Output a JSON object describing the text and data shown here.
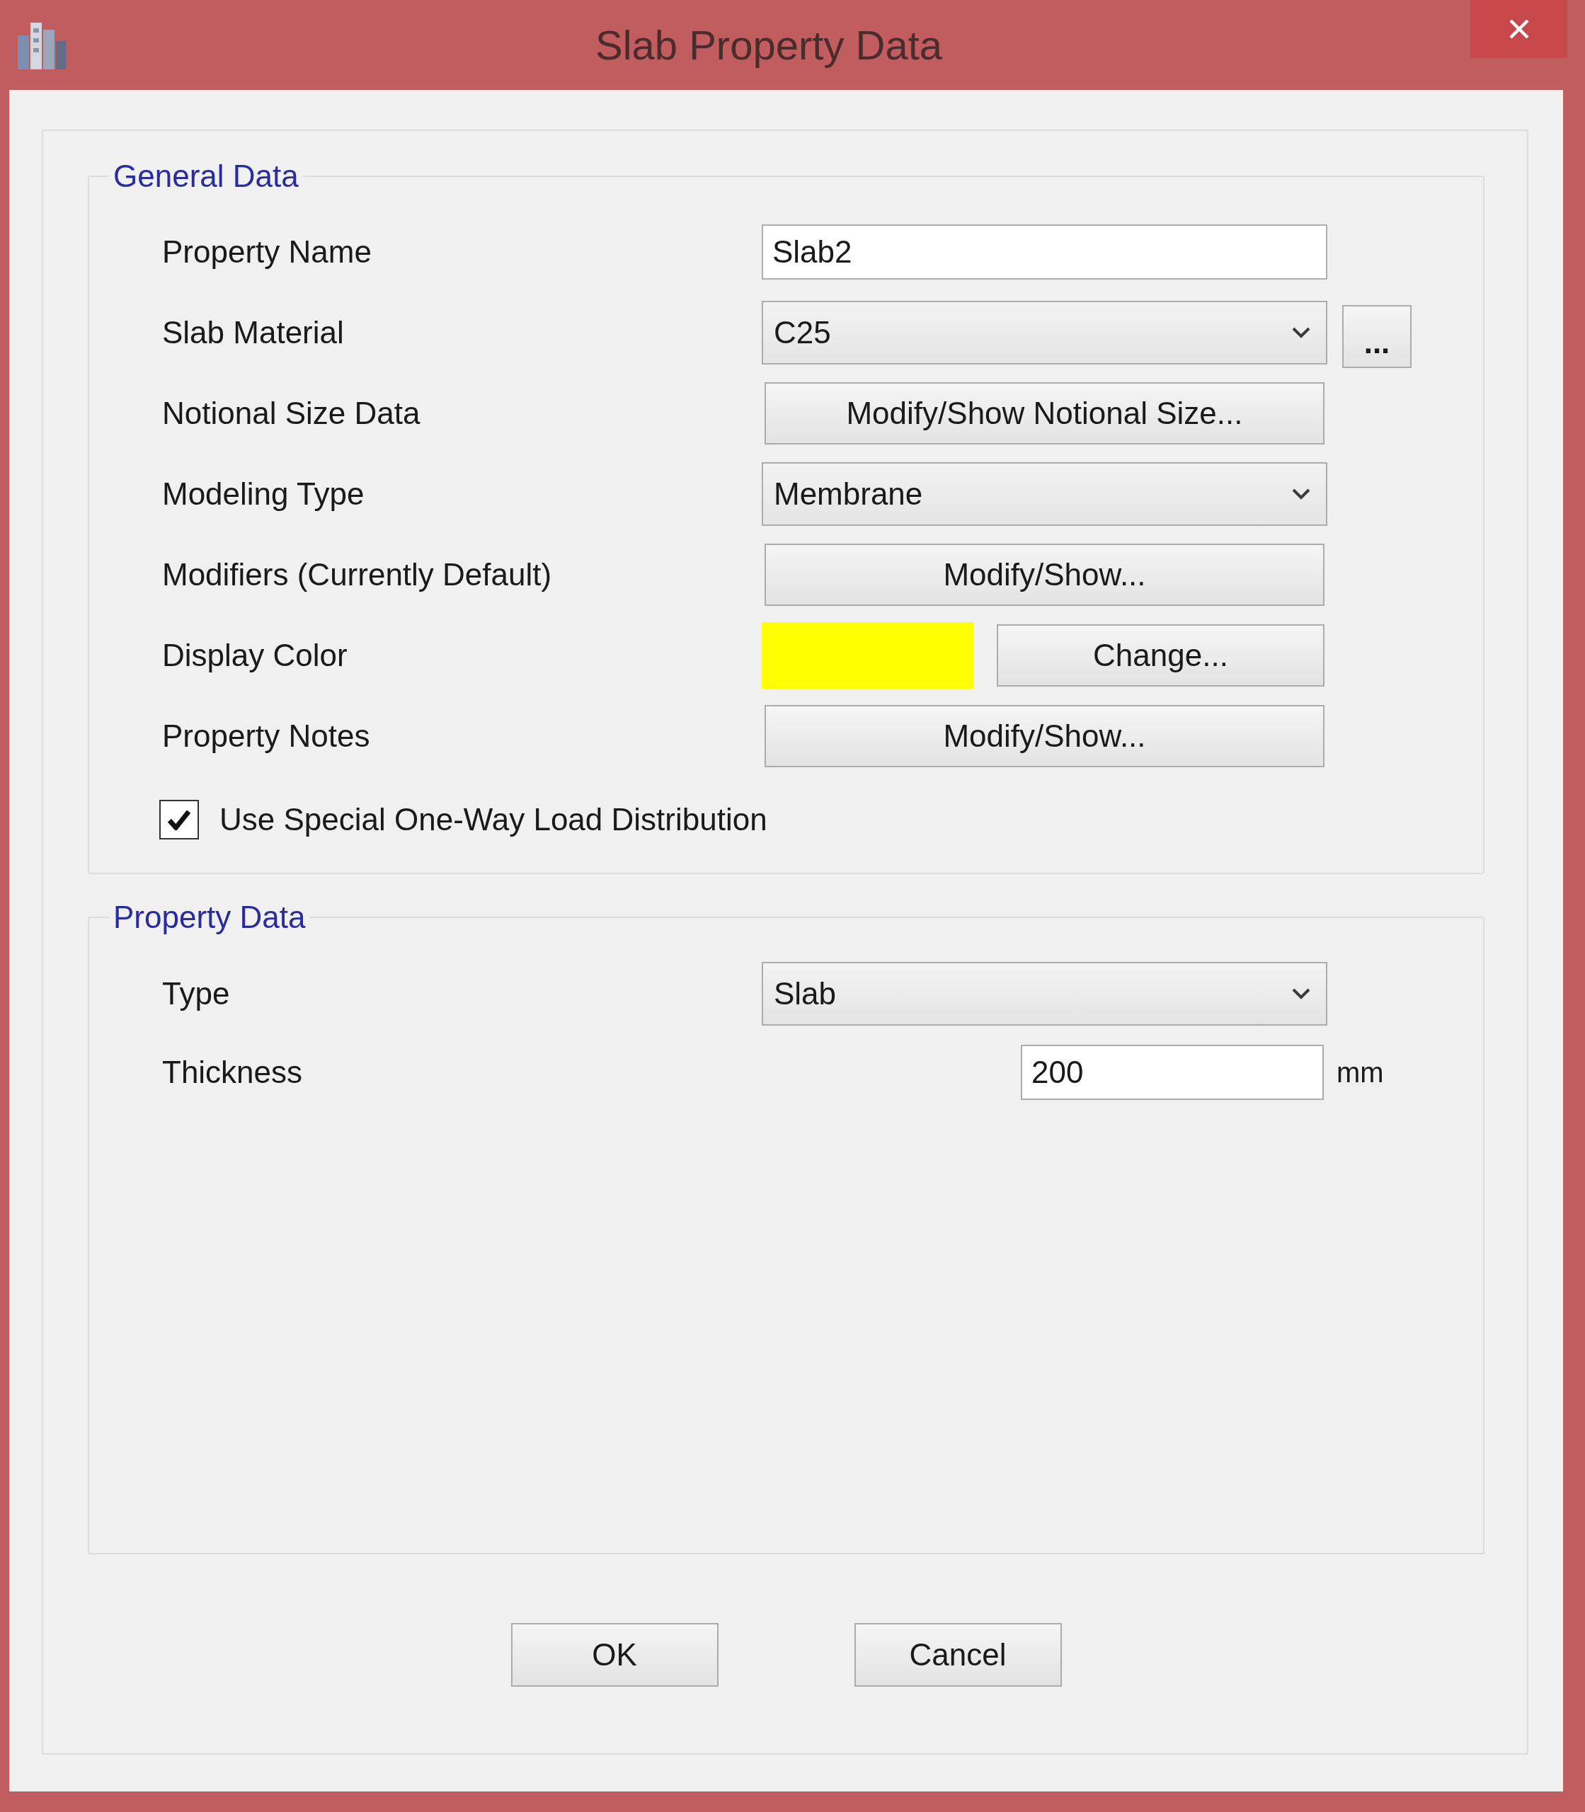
{
  "window": {
    "title": "Slab Property Data"
  },
  "general_data": {
    "title": "General Data",
    "rows": [
      {
        "kind": "text",
        "label": "Property Name",
        "value": "Slab2"
      },
      {
        "kind": "dropdown",
        "label": "Slab Material",
        "value": "C25",
        "extra_button": "..."
      },
      {
        "kind": "button",
        "label": "Notional Size Data",
        "button": "Modify/Show Notional Size..."
      },
      {
        "kind": "dropdown",
        "label": "Modeling Type",
        "value": "Membrane"
      },
      {
        "kind": "button",
        "label": "Modifiers (Currently Default)",
        "button": "Modify/Show..."
      },
      {
        "kind": "color",
        "label": "Display Color",
        "color": "#ffff00",
        "button": "Change..."
      },
      {
        "kind": "button",
        "label": "Property Notes",
        "button": "Modify/Show..."
      }
    ],
    "checkbox": {
      "label": "Use Special One-Way Load Distribution",
      "checked": true
    }
  },
  "property_data": {
    "title": "Property Data",
    "rows": [
      {
        "kind": "dropdown",
        "label": "Type",
        "value": "Slab"
      },
      {
        "kind": "number",
        "label": "Thickness",
        "value": "200",
        "unit": "mm"
      }
    ]
  },
  "buttons": [
    {
      "label": "OK"
    },
    {
      "label": "Cancel"
    }
  ]
}
